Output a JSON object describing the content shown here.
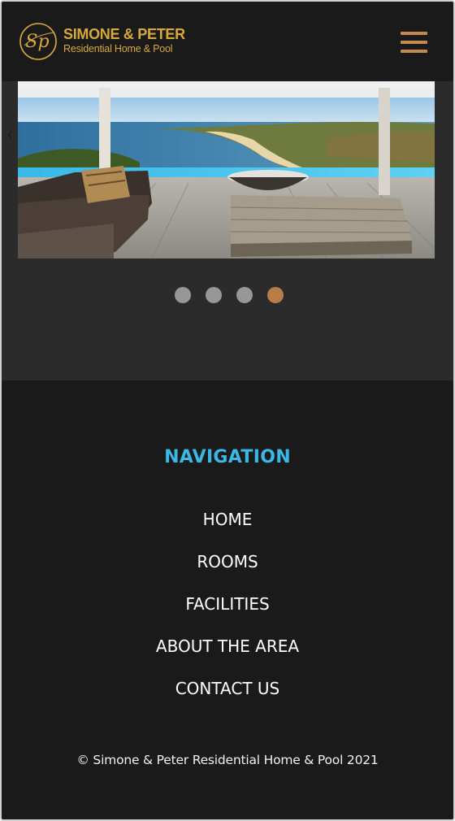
{
  "header": {
    "brand_monogram": "Sp",
    "brand_title": "SIMONE & PETER",
    "brand_subtitle": "Residential Home & Pool",
    "menu_icon": "hamburger-menu-icon"
  },
  "slider": {
    "prev_symbol": "‹",
    "slide_count": 4,
    "active_slide": 4,
    "image_subject": "terrace-infinity-pool-ocean-view"
  },
  "footer": {
    "nav_heading": "NAVIGATION",
    "nav_items": [
      {
        "label": "HOME"
      },
      {
        "label": "ROOMS"
      },
      {
        "label": "FACILITIES"
      },
      {
        "label": "ABOUT THE AREA"
      },
      {
        "label": "CONTACT US"
      }
    ],
    "copyright": "© Simone & Peter Residential Home & Pool 2021"
  },
  "colors": {
    "brand_gold": "#d7a93d",
    "menu_accent": "#c48a4d",
    "nav_heading": "#3bb7e6",
    "dot_active": "#b87c46",
    "dot_inactive": "#979797",
    "background_dark": "#1a1a1a",
    "slider_background": "#2b2b2b"
  }
}
